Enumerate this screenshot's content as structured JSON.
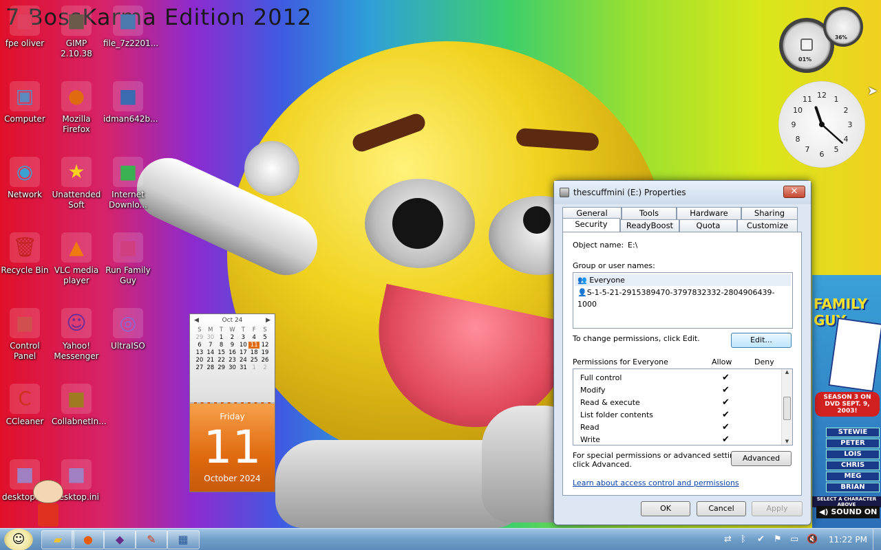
{
  "wallpaper": {
    "title": "7 BossKarma Edition 2012"
  },
  "desktop_icons": [
    {
      "label": "fpe oliver",
      "icon": "shortcut-icon"
    },
    {
      "label": "GIMP 2.10.38",
      "icon": "gimp-icon"
    },
    {
      "label": "file_7z2201...",
      "icon": "installer-icon"
    },
    {
      "label": "Computer",
      "icon": "computer-icon"
    },
    {
      "label": "Mozilla Firefox",
      "icon": "firefox-icon"
    },
    {
      "label": "idman642b...",
      "icon": "idm-installer-icon"
    },
    {
      "label": "Network",
      "icon": "network-icon"
    },
    {
      "label": "Unattended Soft",
      "icon": "star-icon"
    },
    {
      "label": "Internet Downlo...",
      "icon": "idm-icon"
    },
    {
      "label": "Recycle Bin",
      "icon": "recycle-bin-icon"
    },
    {
      "label": "VLC media player",
      "icon": "vlc-icon"
    },
    {
      "label": "Run Family Guy",
      "icon": "family-guy-icon"
    },
    {
      "label": "Control Panel",
      "icon": "control-panel-icon"
    },
    {
      "label": "Yahoo! Messenger",
      "icon": "yahoo-messenger-icon"
    },
    {
      "label": "UltraISO",
      "icon": "ultraiso-icon"
    },
    {
      "label": "CCleaner",
      "icon": "ccleaner-icon"
    },
    {
      "label": "CollabnetIn...",
      "icon": "collabnet-icon"
    },
    {
      "label": "desktop.ini",
      "icon": "ini-file-icon"
    },
    {
      "label": "desktop.ini",
      "icon": "ini-file-icon"
    }
  ],
  "gadgets": {
    "cpu_meter": {
      "cpu": "01%",
      "memory": "36%"
    },
    "clock": {
      "hour": 11,
      "minute": 22
    },
    "calendar": {
      "month_label": "Oct 24",
      "weekdays": [
        "S",
        "M",
        "T",
        "W",
        "T",
        "F",
        "S"
      ],
      "days": [
        "29",
        "30",
        "1",
        "2",
        "3",
        "4",
        "5",
        "6",
        "7",
        "8",
        "9",
        "10",
        "11",
        "12",
        "13",
        "14",
        "15",
        "16",
        "17",
        "18",
        "19",
        "20",
        "21",
        "22",
        "23",
        "24",
        "25",
        "26",
        "27",
        "28",
        "29",
        "30",
        "31",
        "1",
        "2"
      ],
      "today_index": 12,
      "weekday": "Friday",
      "day": "11",
      "month_year": "October 2024"
    }
  },
  "dialog": {
    "title": "thescuffmini (E:) Properties",
    "close_label": "✕",
    "tabs_back": [
      "General",
      "Tools",
      "Hardware",
      "Sharing"
    ],
    "tabs_front": [
      "Security",
      "ReadyBoost",
      "Quota",
      "Customize"
    ],
    "active_tab": "Security",
    "object_name_label": "Object name:",
    "object_name_value": "E:\\",
    "group_label": "Group or user names:",
    "users": [
      "Everyone",
      "S-1-5-21-2915389470-3797832332-2804906439-1000"
    ],
    "change_text": "To change permissions, click Edit.",
    "edit_button": "Edit...",
    "permissions_label": "Permissions for Everyone",
    "allow_label": "Allow",
    "deny_label": "Deny",
    "permissions": [
      {
        "name": "Full control",
        "allow": true,
        "deny": false
      },
      {
        "name": "Modify",
        "allow": true,
        "deny": false
      },
      {
        "name": "Read & execute",
        "allow": true,
        "deny": false
      },
      {
        "name": "List folder contents",
        "allow": true,
        "deny": false
      },
      {
        "name": "Read",
        "allow": true,
        "deny": false
      },
      {
        "name": "Write",
        "allow": true,
        "deny": false
      }
    ],
    "special_text_1": "For special permissions or advanced settings,",
    "special_text_2": "click Advanced.",
    "advanced_button": "Advanced",
    "learn_link": "Learn about access control and permissions",
    "ok_button": "OK",
    "cancel_button": "Cancel",
    "apply_button": "Apply"
  },
  "ad": {
    "brand": "FAMILY GUY",
    "season_text": "SEASON 3 ON DVD SEPT. 9, 2003!",
    "characters": [
      "STEWIE",
      "PETER",
      "LOIS",
      "CHRIS",
      "MEG",
      "BRIAN"
    ],
    "select_text": "SELECT A CHARACTER ABOVE",
    "sound_text": "SOUND ON"
  },
  "taskbar": {
    "time": "11:22 PM",
    "pinned": [
      "explorer-icon",
      "firefox-icon",
      "app-icon",
      "paint-icon",
      "control-panel-icon"
    ]
  }
}
